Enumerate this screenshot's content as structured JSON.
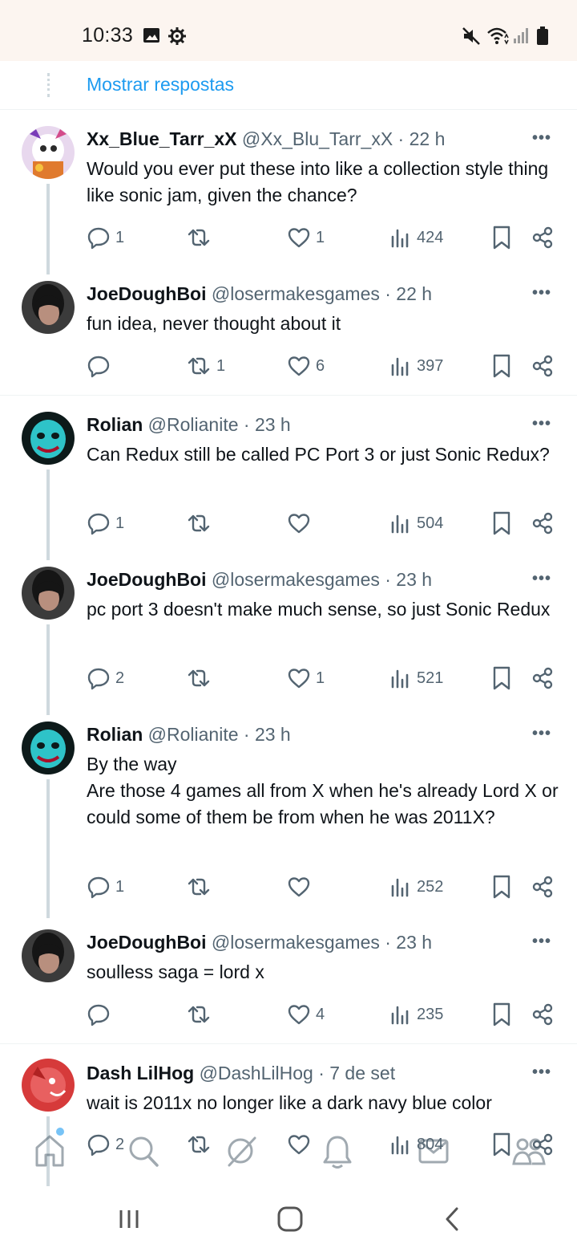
{
  "status": {
    "time": "10:33"
  },
  "thread": {
    "show_replies_label": "Mostrar respostas"
  },
  "tweets": [
    {
      "name": "Xx_Blue_Tarr_xX",
      "meta": "@Xx_Blu_Tarr_xX · 22 h",
      "text": "Would you ever put these into like a collection style thing like sonic jam, given the chance?",
      "replies": "1",
      "retweets": "",
      "likes": "1",
      "views": "424"
    },
    {
      "name": "JoeDoughBoi",
      "meta": "@losermakesgames · 22 h",
      "text": "fun idea, never thought about it",
      "replies": "",
      "retweets": "1",
      "likes": "6",
      "views": "397"
    },
    {
      "name": "Rolian",
      "meta": "@Rolianite · 23 h",
      "text": "Can Redux still be called PC Port 3 or just Sonic Redux?",
      "replies": "1",
      "retweets": "",
      "likes": "",
      "views": "504"
    },
    {
      "name": "JoeDoughBoi",
      "meta": "@losermakesgames · 23 h",
      "text": "pc port 3 doesn't make much sense, so just Sonic Redux",
      "replies": "2",
      "retweets": "",
      "likes": "1",
      "views": "521"
    },
    {
      "name": "Rolian",
      "meta": "@Rolianite · 23 h",
      "text": "By the way\nAre those 4 games all from X when he's already Lord X or could some of them be from when he was 2011X?",
      "replies": "1",
      "retweets": "",
      "likes": "",
      "views": "252"
    },
    {
      "name": "JoeDoughBoi",
      "meta": "@losermakesgames · 23 h",
      "text": "soulless saga = lord x",
      "replies": "",
      "retweets": "",
      "likes": "4",
      "views": "235"
    },
    {
      "name": "Dash LilHog",
      "meta": "@DashLilHog · 7 de set",
      "text": "wait is 2011x no longer like a dark navy blue color",
      "replies": "2",
      "retweets": "",
      "likes": "",
      "views": "804"
    }
  ],
  "colors": {
    "accent": "#1d9bf0",
    "text": "#0f1419",
    "muted": "#536471",
    "status_bar_bg": "#fcf5f0"
  },
  "icons": {
    "reply": "reply-icon",
    "retweet": "retweet-icon",
    "like": "heart-icon",
    "views": "views-icon",
    "bookmark": "bookmark-icon",
    "share": "share-icon",
    "nav": [
      "home-icon",
      "search-icon",
      "grok-icon",
      "notifications-icon",
      "messages-icon",
      "communities-icon"
    ]
  }
}
